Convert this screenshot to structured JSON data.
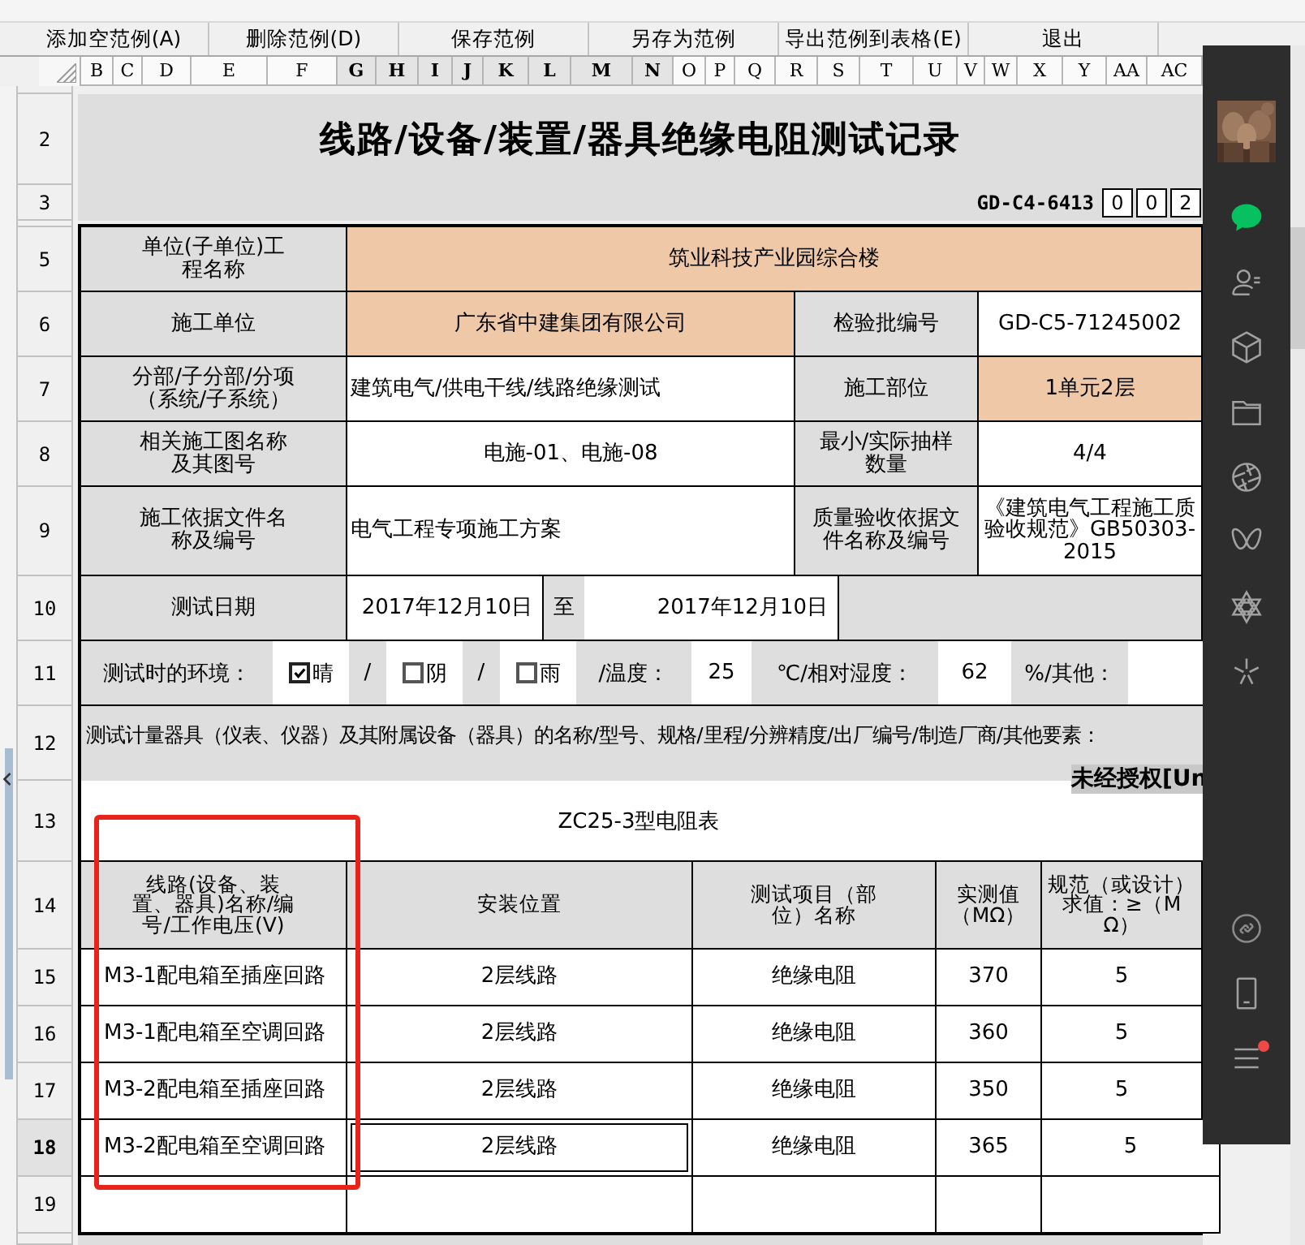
{
  "toolbar": [
    {
      "label": "添加空范例(A)"
    },
    {
      "label": "删除范例(D)"
    },
    {
      "label": "保存范例"
    },
    {
      "label": "另存为范例"
    },
    {
      "label": "导出范例到表格(E)"
    },
    {
      "label": "退出"
    }
  ],
  "column_headers": [
    {
      "label": "B",
      "selected": false
    },
    {
      "label": "C",
      "selected": false
    },
    {
      "label": "D",
      "selected": false
    },
    {
      "label": "E",
      "selected": false
    },
    {
      "label": "F",
      "selected": false
    },
    {
      "label": "G",
      "selected": true
    },
    {
      "label": "H",
      "selected": true
    },
    {
      "label": "I",
      "selected": true
    },
    {
      "label": "J",
      "selected": true
    },
    {
      "label": "K",
      "selected": true
    },
    {
      "label": "L",
      "selected": true
    },
    {
      "label": "M",
      "selected": true
    },
    {
      "label": "N",
      "selected": true
    },
    {
      "label": "O",
      "selected": false
    },
    {
      "label": "P",
      "selected": false
    },
    {
      "label": "Q",
      "selected": false
    },
    {
      "label": "R",
      "selected": false
    },
    {
      "label": "S",
      "selected": false
    },
    {
      "label": "T",
      "selected": false
    },
    {
      "label": "U",
      "selected": false
    },
    {
      "label": "V",
      "selected": false
    },
    {
      "label": "W",
      "selected": false
    },
    {
      "label": "X",
      "selected": false
    },
    {
      "label": "Y",
      "selected": false
    },
    {
      "label": "AA",
      "selected": false
    },
    {
      "label": "AC",
      "selected": false
    }
  ],
  "sheet": {
    "title_row": {
      "row": "2",
      "title": "线路/设备/装置/器具绝缘电阻测试记录"
    },
    "code_row": {
      "row": "3",
      "code": "GD-C4-6413",
      "boxes": [
        "0",
        "0",
        "2"
      ]
    },
    "form_rows": [
      {
        "row": "5",
        "cells": [
          {
            "kind": "label",
            "text": "单位(子单位)工程名称"
          },
          {
            "kind": "highlighted",
            "text": "筑业科技产业园综合楼"
          }
        ]
      },
      {
        "row": "6",
        "cells": [
          {
            "kind": "label",
            "text": "施工单位"
          },
          {
            "kind": "highlighted",
            "text": "广东省中建集团有限公司"
          },
          {
            "kind": "label",
            "text": "检验批编号"
          },
          {
            "kind": "value",
            "text": "GD-C5-71245002"
          }
        ]
      },
      {
        "row": "7",
        "cells": [
          {
            "kind": "label",
            "text": "分部/子分部/分项（系统/子系统）"
          },
          {
            "kind": "note",
            "text": "建筑电气/供电干线/线路绝缘测试"
          },
          {
            "kind": "label",
            "text": "施工部位"
          },
          {
            "kind": "highlighted",
            "text": "1单元2层"
          }
        ]
      },
      {
        "row": "8",
        "cells": [
          {
            "kind": "label",
            "text": "相关施工图名称及其图号"
          },
          {
            "kind": "value",
            "text": "电施-01、电施-08"
          },
          {
            "kind": "label",
            "text": "最小/实际抽样数量"
          },
          {
            "kind": "value",
            "text": "4/4"
          }
        ]
      },
      {
        "row": "9",
        "cells": [
          {
            "kind": "label",
            "text": "施工依据文件名称及编号"
          },
          {
            "kind": "note",
            "text": "电气工程专项施工方案"
          },
          {
            "kind": "label",
            "text": "质量验收依据文件名称及编号"
          },
          {
            "kind": "value",
            "text": "《建筑电气工程施工质验收规范》GB50303-2015"
          }
        ]
      }
    ],
    "date_row": {
      "row": "10",
      "label": "测试日期",
      "from": "2017年12月10日",
      "separator": "至",
      "to": "2017年12月10日"
    },
    "environment_row": {
      "row": "11",
      "items": [
        {
          "kind": "label",
          "text": "测试时的环境："
        },
        {
          "kind": "check",
          "text": "晴",
          "checked": true
        },
        {
          "kind": "label",
          "text": "/"
        },
        {
          "kind": "check",
          "text": "阴",
          "checked": false
        },
        {
          "kind": "label",
          "text": "/"
        },
        {
          "kind": "check",
          "text": "雨",
          "checked": false
        },
        {
          "kind": "label",
          "text": "/温度："
        },
        {
          "kind": "value",
          "text": "25"
        },
        {
          "kind": "label",
          "text": "℃/相对湿度："
        },
        {
          "kind": "value",
          "text": "62"
        },
        {
          "kind": "label",
          "text": "%/其他："
        },
        {
          "kind": "blank"
        }
      ]
    },
    "instruments_row": {
      "row": "12",
      "text": "测试计量器具（仪表、仪器）及其附属设备（器具）的名称/型号、规格/里程/分辨精度/出厂编号/制造厂商/其他要素："
    },
    "notice": "未经授权[Un",
    "instrument_row": {
      "row": "13",
      "text": "ZC25-3型电阻表"
    },
    "results": {
      "row": "14",
      "columns": [
        "线路(设备、装置、器具)名称/编号/工作电压(V)",
        "安装位置",
        "测试项目（部位）名称",
        "实测值（MΩ）",
        "规范（或设计）求值：≥（MΩ）"
      ],
      "rows": [
        {
          "row": "15",
          "selected": false,
          "cells": [
            "M3-1配电箱至插座回路",
            "2层线路",
            "绝缘电阻",
            "370",
            "5"
          ]
        },
        {
          "row": "16",
          "selected": false,
          "cells": [
            "M3-1配电箱至空调回路",
            "2层线路",
            "绝缘电阻",
            "360",
            "5"
          ]
        },
        {
          "row": "17",
          "selected": false,
          "cells": [
            "M3-2配电箱至插座回路",
            "2层线路",
            "绝缘电阻",
            "350",
            "5"
          ]
        },
        {
          "row": "18",
          "selected": true,
          "cells": [
            "M3-2配电箱至空调回路",
            "2层线路",
            "绝缘电阻",
            "365",
            "5"
          ]
        }
      ],
      "empty_rows": [
        "19"
      ]
    }
  }
}
